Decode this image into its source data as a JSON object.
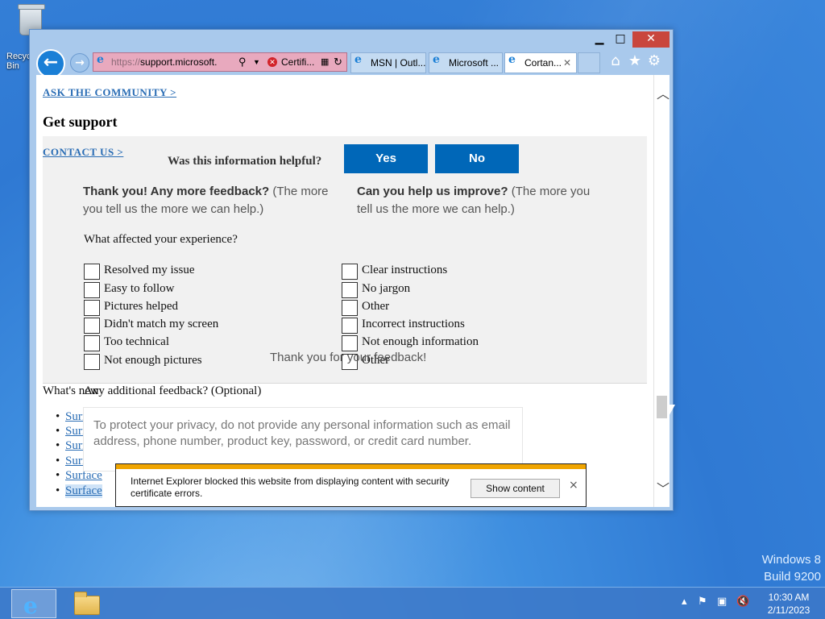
{
  "desktop": {
    "recycle_bin_label": "Recycle Bin",
    "watermark_os": "Windows 8",
    "watermark_build": "Build 9200"
  },
  "window": {
    "minimize": "▁",
    "maximize": "□",
    "close": "✕"
  },
  "address_bar": {
    "url_prefix": "https://",
    "url_main": "support.microsoft.",
    "cert_label": "Certifi..."
  },
  "tabs": [
    {
      "label": "MSN | Outl...",
      "active": false
    },
    {
      "label": "Microsoft ...",
      "active": false
    },
    {
      "label": "Cortan...",
      "active": true
    }
  ],
  "page": {
    "ask_community": "ASK THE COMMUNITY >",
    "get_support": "Get support",
    "contact_us": "CONTACT US >",
    "helpful_question": "Was this information helpful?",
    "yes": "Yes",
    "no": "No",
    "thank_you_bold": "Thank you! Any more feedback?",
    "thank_you_rest": " (The more you tell us the more we can help.)",
    "improve_bold": "Can you help us improve?",
    "improve_rest": " (The more you tell us the more we can help.)",
    "affected_question": "What affected your experience?",
    "checkboxes_left": [
      "Resolved my issue",
      "Easy to follow",
      "Pictures helped",
      "Didn't match my screen",
      "Too technical",
      "Not enough pictures"
    ],
    "checkboxes_right": [
      "Clear instructions",
      "No jargon",
      "Other",
      "Incorrect instructions",
      "Not enough information",
      "Other"
    ],
    "thanks_message": "Thank you for your feedback!",
    "whats_new": "What's new",
    "additional_question": "Any additional feedback? (Optional)",
    "feedback_placeholder": "To protect your privacy, do not provide any personal information such as email address, phone number, product key, password, or credit card number.",
    "bullets": [
      "Surf",
      "Surf",
      "Surf",
      "Surf",
      "Surface",
      "Surface"
    ]
  },
  "notification": {
    "message": "Internet Explorer blocked this website from displaying content with security certificate errors.",
    "button": "Show content",
    "close": "×"
  },
  "taskbar": {
    "time": "10:30 AM",
    "date": "2/11/2023"
  }
}
